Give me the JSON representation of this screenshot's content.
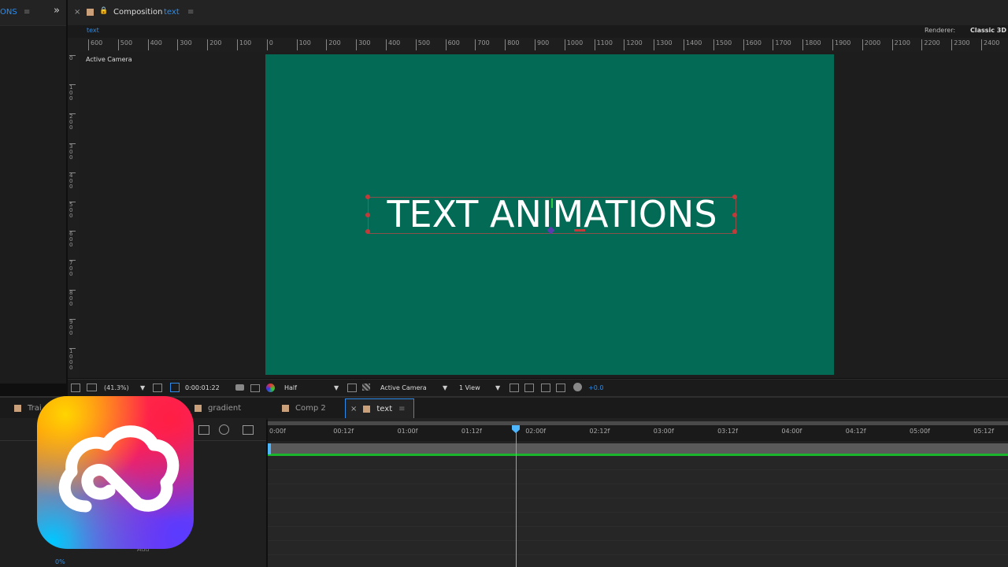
{
  "left_panel": {
    "tab_label": "ONS",
    "expand_glyph": "»",
    "menu_glyph": "≡"
  },
  "comp_panel": {
    "close_glyph": "×",
    "lock_glyph": "🔒",
    "title_prefix": "Composition",
    "title_name": "text",
    "menu_glyph": "≡",
    "subtab": "text",
    "renderer_label": "Renderer:",
    "renderer_value": "Classic 3D",
    "view_label": "Active Camera",
    "ruler_h_ticks": [
      "600",
      "500",
      "400",
      "300",
      "200",
      "100",
      "0",
      "100",
      "200",
      "300",
      "400",
      "500",
      "600",
      "700",
      "800",
      "900",
      "1000",
      "1100",
      "1200",
      "1300",
      "1400",
      "1500",
      "1600",
      "1700",
      "1800",
      "1900",
      "2000",
      "2100",
      "2200",
      "2300",
      "2400"
    ],
    "ruler_v_ticks": [
      "0",
      "100",
      "200",
      "300",
      "400",
      "500",
      "600",
      "700",
      "800",
      "900",
      "1000"
    ]
  },
  "canvas": {
    "text": "TEXT ANIMATIONS",
    "bg_color": "#026a55"
  },
  "comp_toolbar": {
    "zoom": "(41.3%)",
    "timecode": "0:00:01:22",
    "resolution": "Half",
    "camera": "Active Camera",
    "views": "1 View",
    "exposure": "+0.0"
  },
  "timeline": {
    "tabs": [
      {
        "label": "Trai",
        "active": false
      },
      {
        "label": "gradient",
        "active": false
      },
      {
        "label": "Comp 2",
        "active": false
      },
      {
        "label": "text",
        "active": true
      }
    ],
    "time_markers": [
      "0:00f",
      "00:12f",
      "01:00f",
      "01:12f",
      "02:00f",
      "02:12f",
      "03:00f",
      "03:12f",
      "04:00f",
      "04:12f",
      "05:00f",
      "05:12f"
    ],
    "left_bottom_label": "Add",
    "left_bottom_percent": "0%"
  },
  "colors": {
    "accent_blue": "#2d8ceb",
    "work_area_green": "#1bb52b",
    "playhead": "#4db6ff"
  }
}
